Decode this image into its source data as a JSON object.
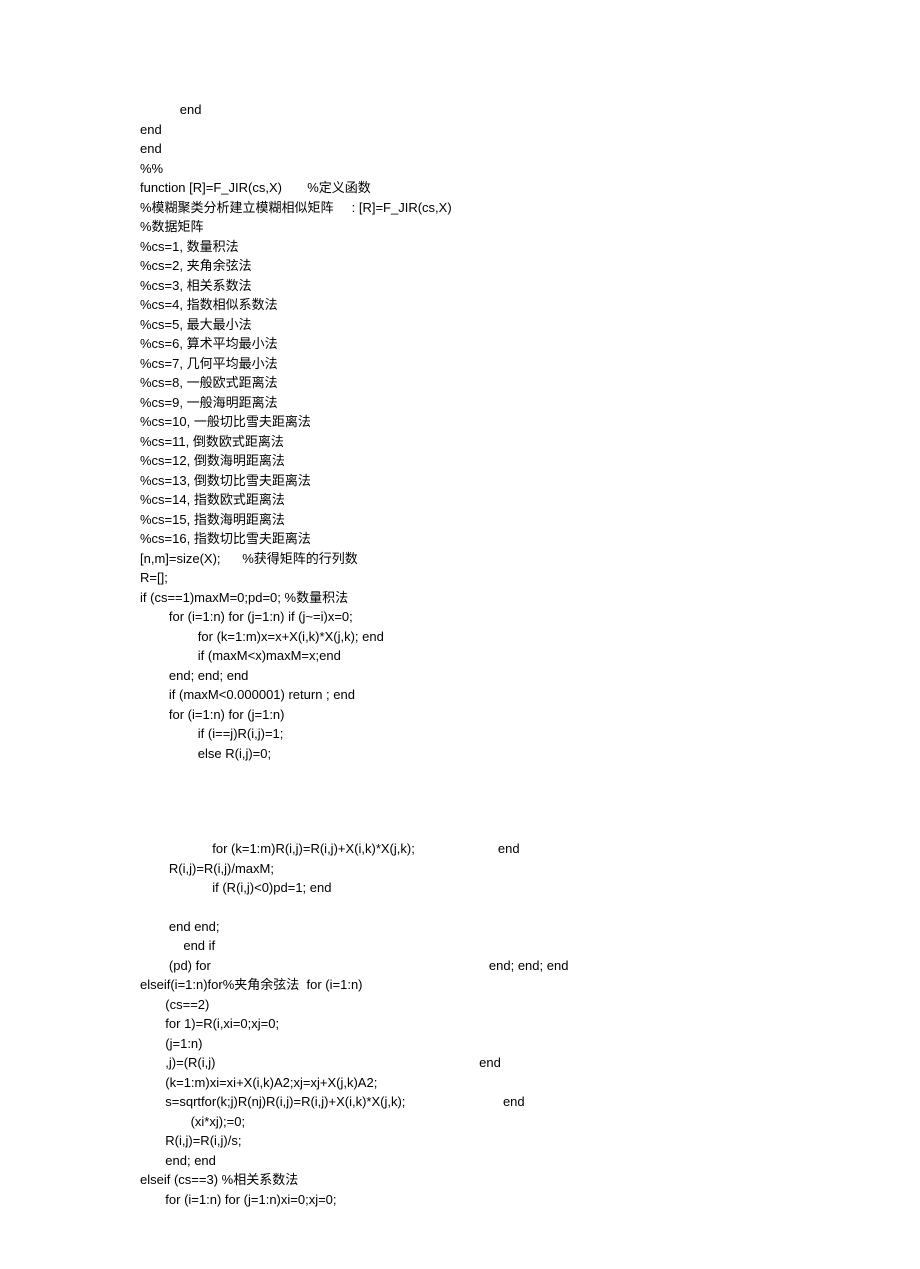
{
  "lines": [
    "           end",
    "end",
    "end",
    "%%",
    "function [R]=F_JIR(cs,X)       %定义函数",
    "%模糊聚类分析建立模糊相似矩阵     : [R]=F_JIR(cs,X)",
    "%数据矩阵",
    "%cs=1, 数量积法",
    "%cs=2, 夹角余弦法",
    "%cs=3, 相关系数法",
    "%cs=4, 指数相似系数法",
    "%cs=5, 最大最小法",
    "%cs=6, 算术平均最小法",
    "%cs=7, 几何平均最小法",
    "%cs=8, 一般欧式距离法",
    "%cs=9, 一般海明距离法",
    "%cs=10, 一般切比雪夫距离法",
    "%cs=11, 倒数欧式距离法",
    "%cs=12, 倒数海明距离法",
    "%cs=13, 倒数切比雪夫距离法",
    "%cs=14, 指数欧式距离法",
    "%cs=15, 指数海明距离法",
    "%cs=16, 指数切比雪夫距离法",
    "[n,m]=size(X);      %获得矩阵的行列数",
    "R=[];",
    "if (cs==1)maxM=0;pd=0; %数量积法",
    "        for (i=1:n) for (j=1:n) if (j~=i)x=0;",
    "                for (k=1:m)x=x+X(i,k)*X(j,k); end",
    "                if (maxM<x)maxM=x;end",
    "        end; end; end",
    "        if (maxM<0.000001) return ; end",
    "        for (i=1:n) for (j=1:n)",
    "                if (i==j)R(i,j)=1;",
    "                else R(i,j)=0;",
    "",
    "",
    "",
    "",
    "                    for (k=1:m)R(i,j)=R(i,j)+X(i,k)*X(j,k);                       end",
    "        R(i,j)=R(i,j)/maxM;",
    "                    if (R(i,j)<0)pd=1; end",
    "",
    "        end end;",
    "            end if",
    "        (pd) for                                                                             end; end; end",
    "elseif(i=1:n)for%夹角余弦法  for (i=1:n)",
    "       (cs==2)",
    "       for 1)=R(i,xi=0;xj=0;",
    "       (j=1:n)",
    "       ,j)=(R(i,j)                                                                         end",
    "       (k=1:m)xi=xi+X(i,k)A2;xj=xj+X(j,k)A2;",
    "       s=sqrtfor(k;j)R(nj)R(i,j)=R(i,j)+X(i,k)*X(j,k);                           end",
    "              (xi*xj);=0;",
    "       R(i,j)=R(i,j)/s;",
    "       end; end",
    "elseif (cs==3) %相关系数法",
    "       for (i=1:n) for (j=1:n)xi=0;xj=0;"
  ]
}
